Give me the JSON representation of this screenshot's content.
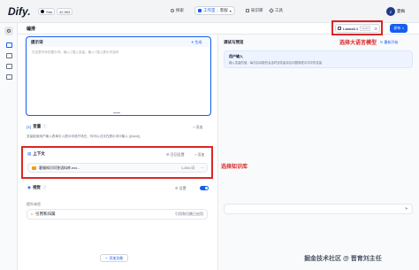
{
  "topbar": {
    "logo": "Dify.",
    "star_label": "Star",
    "star_count": "42,963",
    "nav": [
      "探索",
      "工作室",
      "知识库",
      "工具"
    ],
    "workspace_label": "客服",
    "user_initial": "Z",
    "user_name": "夏梅"
  },
  "editor": {
    "title": "编排",
    "prompt": {
      "label": "提示词",
      "generate_label": "生成",
      "placeholder": "在这里写你的提示词，输入'{'插入变量、输入'/'插入提示内容块"
    },
    "variables": {
      "label": "变量",
      "add_label": "添加",
      "description": "变量能使用户输入表单引入提示词或开场白，你可以试试在提示词中输入 {{input}}"
    },
    "context": {
      "label": "上下文",
      "recall_label": "召回设置",
      "add_label": "添加",
      "dataset_name": "客服知识问答语料库.md...",
      "dataset_meta": "1,284 词"
    },
    "vision": {
      "label": "视觉",
      "settings_label": "设置"
    },
    "features": {
      "section_label": "提升体验",
      "citation_label": "引用和归属",
      "citation_status": "引用和归属已启用"
    },
    "add_feature_label": "添加功能"
  },
  "debug": {
    "title": "调试与预览",
    "model_name": "Llama3.1",
    "model_tag": "CHAT",
    "publish_label": "发布",
    "restart_label": "重新开始",
    "user_input_title": "用户输入",
    "user_input_hint": "输入变量的值，每次启动新的会话时该变量将自动替换提示词中的变量"
  },
  "annotations": {
    "model_note": "选择大语言模型",
    "kb_note": "选择知识库"
  },
  "watermark": "掘金技术社区 @ 晋育刘主任",
  "colors": {
    "accent": "#155eef",
    "annotation": "#dc2626",
    "prompt_border": "#155eef"
  }
}
